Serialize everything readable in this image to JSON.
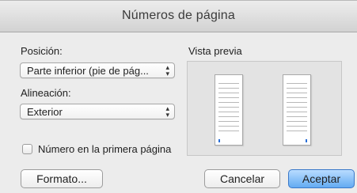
{
  "window": {
    "title": "Números de página"
  },
  "position": {
    "label": "Posición:",
    "selected": "Parte inferior (pie de pág..."
  },
  "alignment": {
    "label": "Alineación:",
    "selected": "Exterior"
  },
  "preview": {
    "label": "Vista previa"
  },
  "first_page_checkbox": {
    "label": "Número en la primera página",
    "checked": false
  },
  "buttons": {
    "format": "Formato...",
    "cancel": "Cancelar",
    "accept": "Aceptar"
  },
  "icons": {
    "popup_arrows": "up-down-arrows-icon"
  },
  "colors": {
    "accent": "#63abf2",
    "desktop": "#1f8fe0",
    "marker": "#2a6fd8"
  }
}
